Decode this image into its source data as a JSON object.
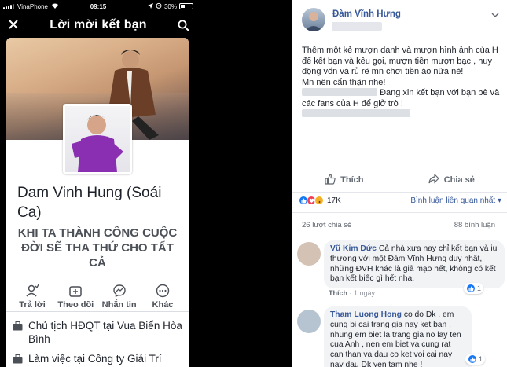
{
  "phone": {
    "carrier": "VinaPhone",
    "time": "09:15",
    "battery": "30%",
    "title": "Lời mời kết bạn",
    "profile_name": "Dam Vinh Hung (Soái Ca)",
    "bio": "KHI TA THÀNH CÔNG CUỘC ĐỜI SẼ THA THỨ CHO TẤT CẢ",
    "actions": [
      {
        "label": "Trả lời",
        "icon": "reply-person-icon"
      },
      {
        "label": "Theo dõi",
        "icon": "follow-icon"
      },
      {
        "label": "Nhắn tin",
        "icon": "messenger-icon"
      },
      {
        "label": "Khác",
        "icon": "more-icon"
      }
    ],
    "info": [
      {
        "text": "Chủ tịch HĐQT tại Vua Biển Hòa Bình",
        "icon": "briefcase-icon"
      },
      {
        "text": "Làm việc tại Công ty Giải Trí",
        "icon": "briefcase-icon"
      }
    ]
  },
  "post": {
    "author": "Đàm Vĩnh Hưng",
    "text_line1": "Thêm một kẻ mượn danh và mượn hình ảnh của H để kết bạn và kêu gọi, mượn tiền mượn bạc , huy động vốn và rủ rê mn chơi tiền ảo nữa nè!",
    "text_line2": "Mn nên cẩn thận nhe!",
    "text_line3": "Đang xin kết bạn với bạn bè và các fans của H để giở trò !",
    "like_label": "Thích",
    "share_label": "Chia sẻ",
    "reaction_count": "17K",
    "sort_label": "Bình luận liên quan nhất",
    "shares": "26 lượt chia sẻ",
    "comments_count": "88 bình luận"
  },
  "comments": [
    {
      "name": "Vũ Kim Đức",
      "text": "Cả nhà xưa nay chỉ kết bạn và iu thương với một Đàm Vĩnh Hưng duy nhất, những ĐVH khác là giả mạo hết, không có kết bạn kết biếc gì hết nha.",
      "like": "Thích",
      "time": "1 ngày",
      "likes": "1"
    },
    {
      "name": "Tham Luong Hong",
      "text": "co do Dk , em cung bi cai trang gia nay ket ban , nhung em biet la trang gia no lay ten cua Anh , nen em biet va cung rat can than va dau co ket voi cai nay nay dau Dk yen tam nhe !",
      "likes": "1"
    }
  ],
  "colors": {
    "fb_blue": "#365899",
    "like_blue": "#1877f2",
    "love_red": "#f33e58",
    "wow_yellow": "#f7b125"
  }
}
